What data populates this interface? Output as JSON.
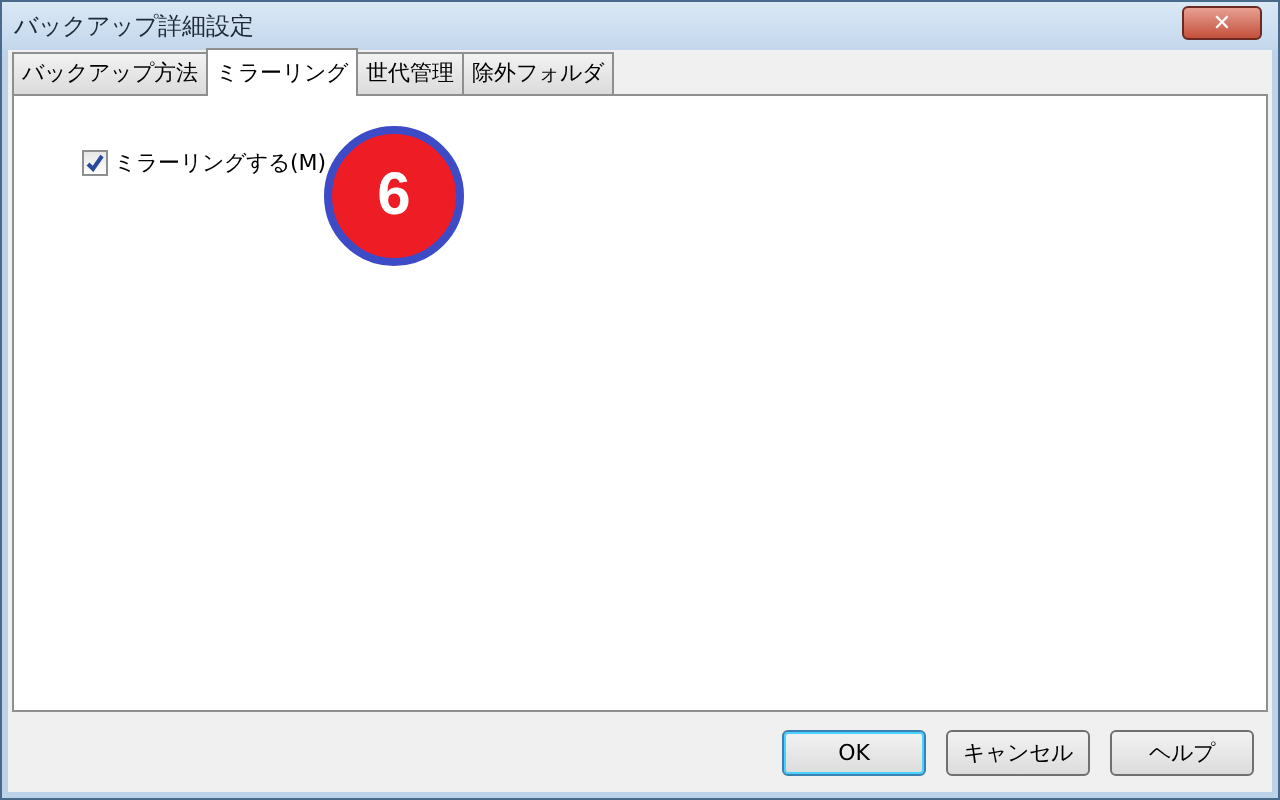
{
  "window": {
    "title": "バックアップ詳細設定",
    "close": "✕"
  },
  "tabs": [
    {
      "label": "バックアップ方法",
      "selected": false
    },
    {
      "label": "ミラーリング",
      "selected": true
    },
    {
      "label": "世代管理",
      "selected": false
    },
    {
      "label": "除外フォルダ",
      "selected": false
    }
  ],
  "options": [
    {
      "label": "ミラーリングする(M)",
      "checked": true
    }
  ],
  "badge": "6",
  "buttons": [
    {
      "label": "OK",
      "default": true
    },
    {
      "label": "キャンセル",
      "default": false
    },
    {
      "label": "ヘルプ",
      "default": false
    }
  ]
}
